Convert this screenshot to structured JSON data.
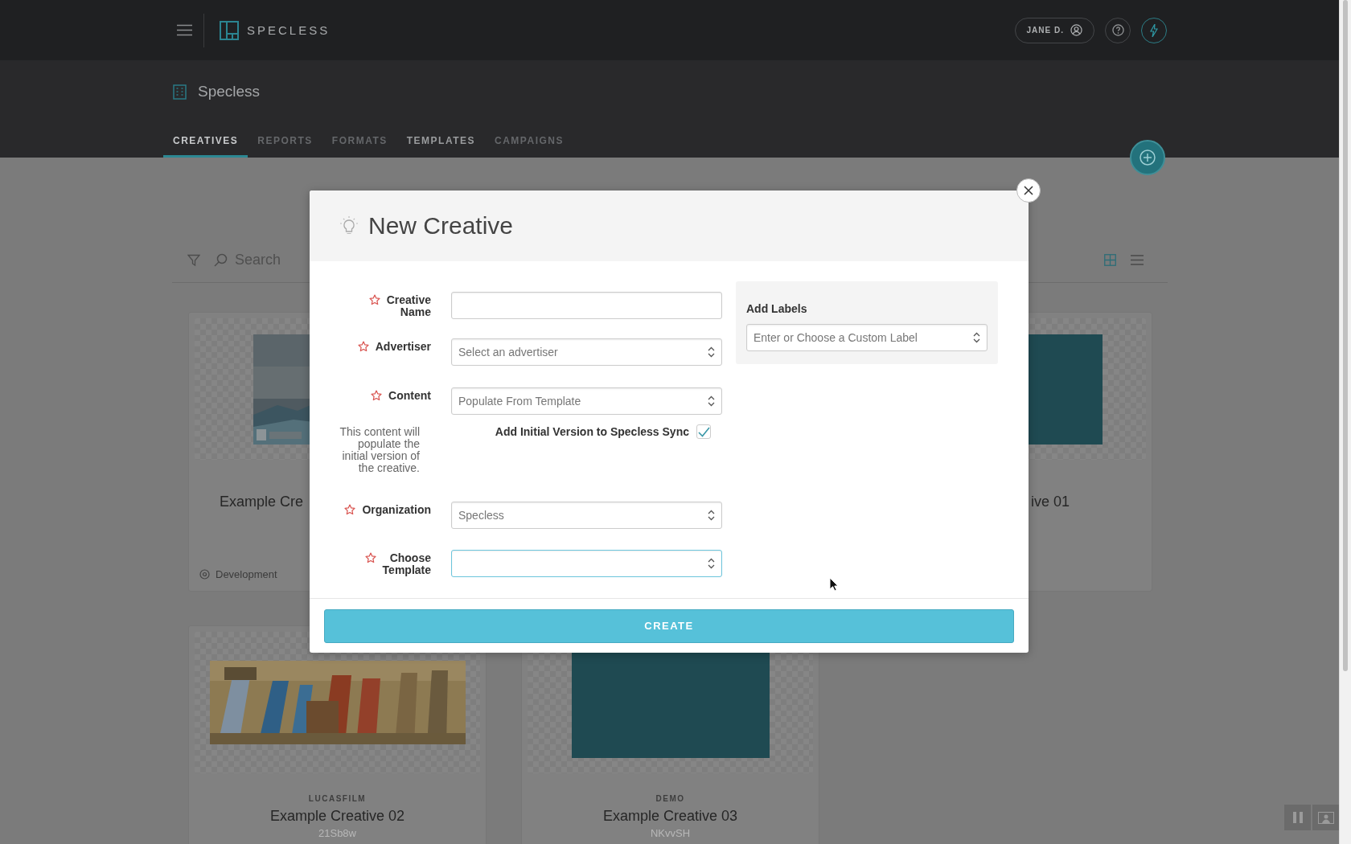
{
  "top_bar": {
    "logo_text": "SPECLESS",
    "user_button": "JANE D."
  },
  "workspace": {
    "title": "Specless"
  },
  "tabs": [
    {
      "label": "CREATIVES",
      "selected": true,
      "disabled": false
    },
    {
      "label": "REPORTS",
      "selected": false,
      "disabled": true
    },
    {
      "label": "FORMATS",
      "selected": false,
      "disabled": true
    },
    {
      "label": "TEMPLATES",
      "selected": false,
      "disabled": false
    },
    {
      "label": "CAMPAIGNS",
      "selected": false,
      "disabled": true
    }
  ],
  "toolbar": {
    "search_placeholder": "Search",
    "view_modes": [
      {
        "kind": "grid",
        "selected": true
      },
      {
        "kind": "list",
        "selected": false
      }
    ]
  },
  "cards": [
    {
      "kind": "cut-right",
      "thumbnail": {
        "kind": "landscape"
      },
      "title": "Example Cre",
      "status": "Development"
    },
    {
      "kind": "cut-left",
      "thumbnail": {
        "kind": "solid"
      },
      "title": "ive 01"
    },
    {
      "kind": "full",
      "thumbnail": {
        "kind": "banner"
      },
      "advertiser": "LUCASFILM",
      "title": "Example Creative 02",
      "code": "21Sb8w"
    },
    {
      "kind": "full",
      "thumbnail": {
        "kind": "solid"
      },
      "advertiser": "DEMO",
      "title": "Example Creative 03",
      "code": "NKvvSH"
    }
  ],
  "modal": {
    "title": "New Creative",
    "fields": [
      {
        "kind": "text",
        "label": "Creative Name",
        "required": true,
        "focused": false
      },
      {
        "kind": "select",
        "label": "Advertiser",
        "required": true,
        "focused": false,
        "placeholder": "Select an advertiser"
      },
      {
        "kind": "select",
        "label": "Content",
        "required": true,
        "focused": false,
        "placeholder": "Populate From Template",
        "note": "This content will populate the initial version of the creative.",
        "checkbox": {
          "label": "Add Initial Version to Specless Sync",
          "checked": true
        }
      },
      {
        "kind": "select",
        "label": "Organization",
        "required": true,
        "focused": false,
        "value": "Specless"
      },
      {
        "kind": "select",
        "label": "Choose Template",
        "required": true,
        "focused": true
      }
    ],
    "labels_panel": {
      "title": "Add Labels",
      "placeholder": "Enter or Choose a Custom Label"
    },
    "submit": "CREATE"
  }
}
